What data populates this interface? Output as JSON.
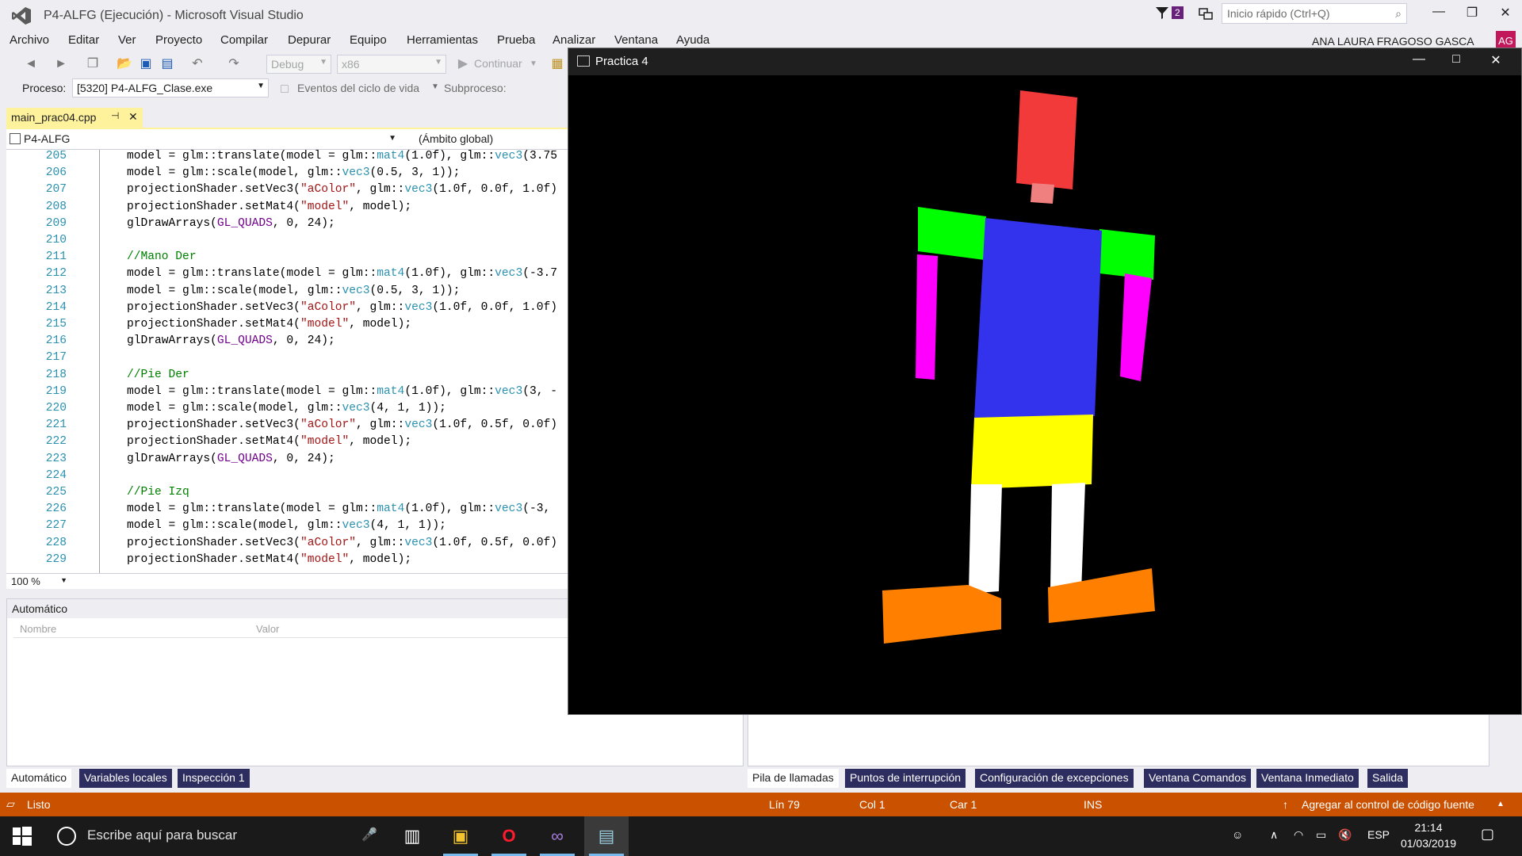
{
  "window": {
    "title": "P4-ALFG (Ejecución) - Microsoft Visual Studio",
    "notification_count": "2",
    "quick_launch_placeholder": "Inicio rápido (Ctrl+Q)",
    "user_name": "ANA LAURA FRAGOSO GASCA",
    "user_initials": "AG"
  },
  "menu": [
    "Archivo",
    "Editar",
    "Ver",
    "Proyecto",
    "Compilar",
    "Depurar",
    "Equipo",
    "Herramientas",
    "Prueba",
    "Analizar",
    "Ventana",
    "Ayuda"
  ],
  "toolbar": {
    "config": "Debug",
    "platform": "x86",
    "continue_label": "Continuar",
    "process_label": "Proceso:",
    "process_value": "[5320] P4-ALFG_Clase.exe",
    "lifecycle_label": "Eventos del ciclo de vida",
    "subprocess_label": "Subproceso:"
  },
  "editor": {
    "tab_name": "main_prac04.cpp",
    "project": "P4-ALFG",
    "scope": "(Ámbito global)",
    "zoom": "100 %",
    "lines": [
      {
        "n": "205",
        "text": "model = glm::translate(model = glm::mat4(1.0f), glm::vec3(3.75"
      },
      {
        "n": "206",
        "text": "model = glm::scale(model, glm::vec3(0.5, 3, 1));"
      },
      {
        "n": "207",
        "text": "projectionShader.setVec3(\"aColor\", glm::vec3(1.0f, 0.0f, 1.0f)"
      },
      {
        "n": "208",
        "text": "projectionShader.setMat4(\"model\", model);"
      },
      {
        "n": "209",
        "text": "glDrawArrays(GL_QUADS, 0, 24);"
      },
      {
        "n": "210",
        "text": ""
      },
      {
        "n": "211",
        "text": "//Mano Der"
      },
      {
        "n": "212",
        "text": "model = glm::translate(model = glm::mat4(1.0f), glm::vec3(-3.7"
      },
      {
        "n": "213",
        "text": "model = glm::scale(model, glm::vec3(0.5, 3, 1));"
      },
      {
        "n": "214",
        "text": "projectionShader.setVec3(\"aColor\", glm::vec3(1.0f, 0.0f, 1.0f)"
      },
      {
        "n": "215",
        "text": "projectionShader.setMat4(\"model\", model);"
      },
      {
        "n": "216",
        "text": "glDrawArrays(GL_QUADS, 0, 24);"
      },
      {
        "n": "217",
        "text": ""
      },
      {
        "n": "218",
        "text": "//Pie Der"
      },
      {
        "n": "219",
        "text": "model = glm::translate(model = glm::mat4(1.0f), glm::vec3(3, -"
      },
      {
        "n": "220",
        "text": "model = glm::scale(model, glm::vec3(4, 1, 1));"
      },
      {
        "n": "221",
        "text": "projectionShader.setVec3(\"aColor\", glm::vec3(1.0f, 0.5f, 0.0f)"
      },
      {
        "n": "222",
        "text": "projectionShader.setMat4(\"model\", model);"
      },
      {
        "n": "223",
        "text": "glDrawArrays(GL_QUADS, 0, 24);"
      },
      {
        "n": "224",
        "text": ""
      },
      {
        "n": "225",
        "text": "//Pie Izq"
      },
      {
        "n": "226",
        "text": "model = glm::translate(model = glm::mat4(1.0f), glm::vec3(-3,"
      },
      {
        "n": "227",
        "text": "model = glm::scale(model, glm::vec3(4, 1, 1));"
      },
      {
        "n": "228",
        "text": "projectionShader.setVec3(\"aColor\", glm::vec3(1.0f, 0.5f, 0.0f)"
      },
      {
        "n": "229",
        "text": "projectionShader.setMat4(\"model\", model);"
      }
    ]
  },
  "autos_panel": {
    "title": "Automático",
    "col_name": "Nombre",
    "col_value": "Valor",
    "tabs": [
      "Automático",
      "Variables locales",
      "Inspección 1"
    ]
  },
  "debug_tabs": [
    "Pila de llamadas",
    "Puntos de interrupción",
    "Configuración de excepciones",
    "Ventana Comandos",
    "Ventana Inmediato",
    "Salida"
  ],
  "status": {
    "state": "Listo",
    "line": "Lín 79",
    "col": "Col 1",
    "char": "Car 1",
    "mode": "INS",
    "source_control": "Agregar al control de código fuente"
  },
  "taskbar": {
    "search_placeholder": "Escribe aquí para buscar",
    "language": "ESP",
    "time": "21:14",
    "date": "01/03/2019"
  },
  "gl_window": {
    "title": "Practica 4",
    "part_colors": {
      "head": "#F23A3A",
      "neck": "#F08080",
      "shoulders": "#00FF00",
      "torso": "#3333EE",
      "arms": "#FF00FF",
      "hips": "#FFFF00",
      "legs": "#FFFFFF",
      "feet": "#FF8000"
    }
  },
  "colors": {
    "accent_status": "#CA5100",
    "tab_active": "#FFF29D"
  }
}
